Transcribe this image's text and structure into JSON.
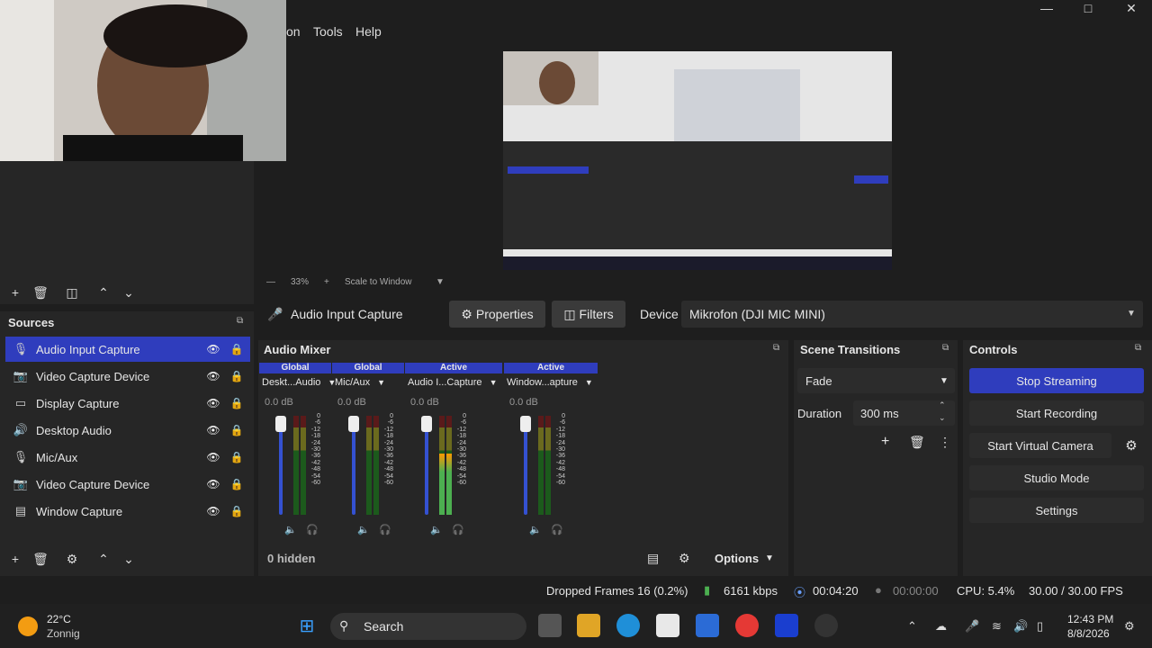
{
  "menu": [
    "on",
    "Tools",
    "Help"
  ],
  "window_controls": [
    "minimize-icon",
    "maximize-icon",
    "close-icon"
  ],
  "preview": {
    "zoom": "33%",
    "scale_mode": "Scale to Window"
  },
  "sources": {
    "title": "Sources",
    "items": [
      {
        "label": "Audio Input Capture",
        "icon": "microphone-icon",
        "selected": true
      },
      {
        "label": "Video Capture Device",
        "icon": "camera-icon",
        "selected": false
      },
      {
        "label": "Display Capture",
        "icon": "monitor-icon",
        "selected": false
      },
      {
        "label": "Desktop Audio",
        "icon": "speaker-icon",
        "selected": false
      },
      {
        "label": "Mic/Aux",
        "icon": "microphone-icon",
        "selected": false
      },
      {
        "label": "Video Capture Device",
        "icon": "camera-icon",
        "selected": false
      },
      {
        "label": "Window Capture",
        "icon": "window-icon",
        "selected": false
      }
    ]
  },
  "properties_bar": {
    "source_name": "Audio Input Capture",
    "properties_label": "Properties",
    "filters_label": "Filters",
    "device_label": "Device",
    "device_value": "Mikrofon (DJI MIC MINI)"
  },
  "audio_mixer": {
    "title": "Audio Mixer",
    "channels": [
      {
        "badge": "Global",
        "name": "Deskt...Audio",
        "db": "0.0 dB",
        "level": 0.0
      },
      {
        "badge": "Global",
        "name": "Mic/Aux",
        "db": "0.0 dB",
        "level": 0.0
      },
      {
        "badge": "Active",
        "name": "Audio I...Capture",
        "db": "0.0 dB",
        "level": 0.62
      },
      {
        "badge": "Active",
        "name": "Window...apture",
        "db": "0.0 dB",
        "level": 0.0
      }
    ],
    "scale": [
      "0",
      "-6",
      "-12",
      "-18",
      "-24",
      "-30",
      "-36",
      "-42",
      "-48",
      "-54",
      "-60"
    ],
    "hidden_label": "0 hidden",
    "options_label": "Options"
  },
  "scene_transitions": {
    "title": "Scene Transitions",
    "transition": "Fade",
    "duration_label": "Duration",
    "duration_value": "300 ms"
  },
  "controls": {
    "title": "Controls",
    "stop_streaming": "Stop Streaming",
    "start_recording": "Start Recording",
    "start_virtual_camera": "Start Virtual Camera",
    "studio_mode": "Studio Mode",
    "settings": "Settings"
  },
  "status": {
    "dropped_frames": "Dropped Frames 16 (0.2%)",
    "bitrate": "6161 kbps",
    "stream_time": "00:04:20",
    "record_time": "00:00:00",
    "cpu": "CPU: 5.4%",
    "fps": "30.00 / 30.00 FPS"
  },
  "taskbar": {
    "weather_temp": "22°C",
    "weather_desc": "Zonnig",
    "search_label": "Search",
    "time": "12:43 PM",
    "date": "8/8/2026"
  },
  "colors": {
    "accent": "#2f3dbd",
    "panel": "#262626",
    "background": "#1e1e1e"
  }
}
